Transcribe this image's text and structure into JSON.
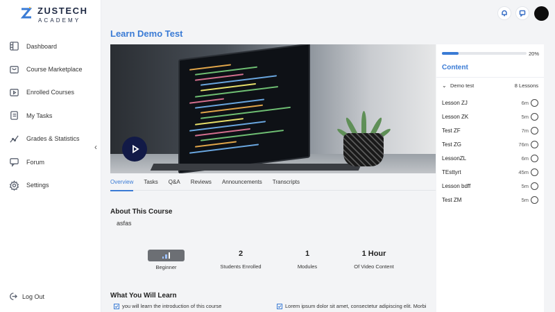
{
  "brand": {
    "name": "ZUSTECH",
    "sub": "ACADEMY"
  },
  "sidebar": {
    "items": [
      {
        "label": "Dashboard",
        "icon": "dashboard-icon"
      },
      {
        "label": "Course Marketplace",
        "icon": "marketplace-icon"
      },
      {
        "label": "Enrolled Courses",
        "icon": "enrolled-icon"
      },
      {
        "label": "My Tasks",
        "icon": "tasks-icon"
      },
      {
        "label": "Grades & Statistics",
        "icon": "grades-icon"
      },
      {
        "label": "Forum",
        "icon": "forum-icon"
      },
      {
        "label": "Settings",
        "icon": "gear-icon"
      }
    ],
    "logout": "Log Out"
  },
  "page": {
    "title": "Learn Demo Test"
  },
  "tabs": [
    "Overview",
    "Tasks",
    "Q&A",
    "Reviews",
    "Announcements",
    "Transcripts"
  ],
  "about": {
    "title": "About This Course",
    "description": "asfas"
  },
  "stats": [
    {
      "value": "",
      "label": "Beginner"
    },
    {
      "value": "2",
      "label": "Students Enrolled"
    },
    {
      "value": "1",
      "label": "Modules"
    },
    {
      "value": "1 Hour",
      "label": "Of Video Content"
    }
  ],
  "learn": {
    "title": "What You Will Learn",
    "items": [
      "you will learn the introduction of this course",
      "Lorem ipsum dolor sit amet, consectetur adipiscing elit. Morbi"
    ]
  },
  "panel": {
    "progress": 0.2,
    "progress_label": "20%",
    "title": "Content",
    "section": {
      "name": "Demo test",
      "count": "8 Lessons"
    },
    "lessons": [
      {
        "name": "Lesson ZJ",
        "duration": "6m"
      },
      {
        "name": "Lesson ZK",
        "duration": "5m"
      },
      {
        "name": "Test ZF",
        "duration": "7m"
      },
      {
        "name": "Test ZG",
        "duration": "76m"
      },
      {
        "name": "LessonZL",
        "duration": "6m"
      },
      {
        "name": "TEsttyrt",
        "duration": "45m"
      },
      {
        "name": "Lesson bdff",
        "duration": "5m"
      },
      {
        "name": "Test ZM",
        "duration": "5m"
      }
    ]
  },
  "colors": {
    "accent": "#3a7bd5",
    "play": "#121a47"
  }
}
